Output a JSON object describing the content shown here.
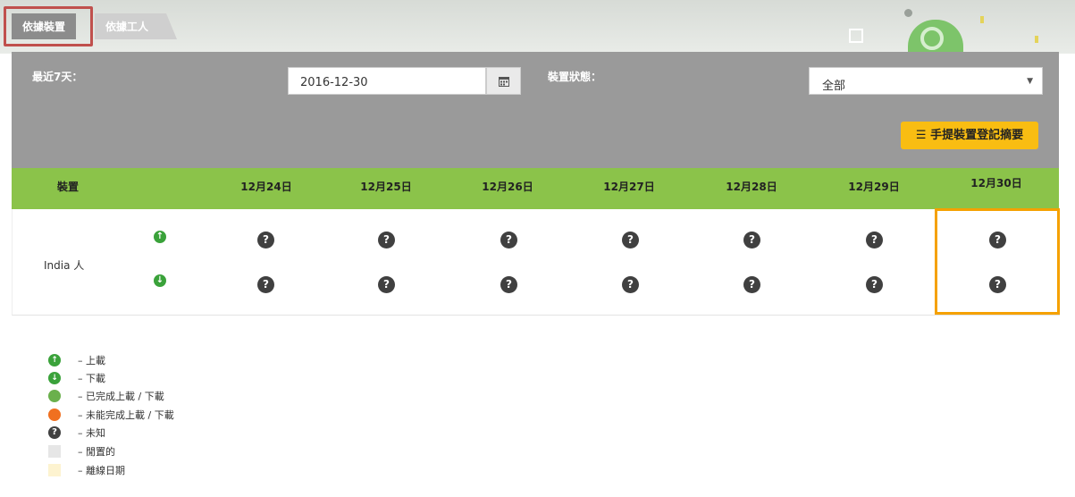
{
  "tabs": {
    "by_device": "依據裝置",
    "by_worker": "依據工人"
  },
  "filters": {
    "recent_label": "最近7天：",
    "date_value": "2016-12-30",
    "status_label": "裝置狀態：",
    "status_value": "全部",
    "summary_button": "手提裝置登記摘要"
  },
  "table": {
    "device_header": "裝置",
    "days": [
      "12月24日",
      "12月25日",
      "12月26日",
      "12月27日",
      "12月28日",
      "12月29日",
      "12月30日"
    ],
    "row": {
      "device": "India 人",
      "upload_icon": "↑",
      "download_icon": "↓",
      "unknown_icon": "?"
    }
  },
  "legend": {
    "upload": "– 上載",
    "download": "– 下載",
    "done": "– 已完成上載 / 下載",
    "failed": "– 未能完成上載 / 下載",
    "unknown": "– 未知",
    "idle": "– 閒置的",
    "offline": "– 離線日期"
  },
  "icons": {
    "calendar": "calendar-icon",
    "list": "list-icon",
    "unknown": "question-icon",
    "upload": "upload-arrow-icon",
    "download": "download-arrow-icon"
  },
  "colors": {
    "header_green": "#8bc34a",
    "panel_gray": "#9a9a9a",
    "accent_yellow": "#f9bd12",
    "highlight_orange": "#f5a100",
    "tab_outline_red": "#c0504d"
  }
}
